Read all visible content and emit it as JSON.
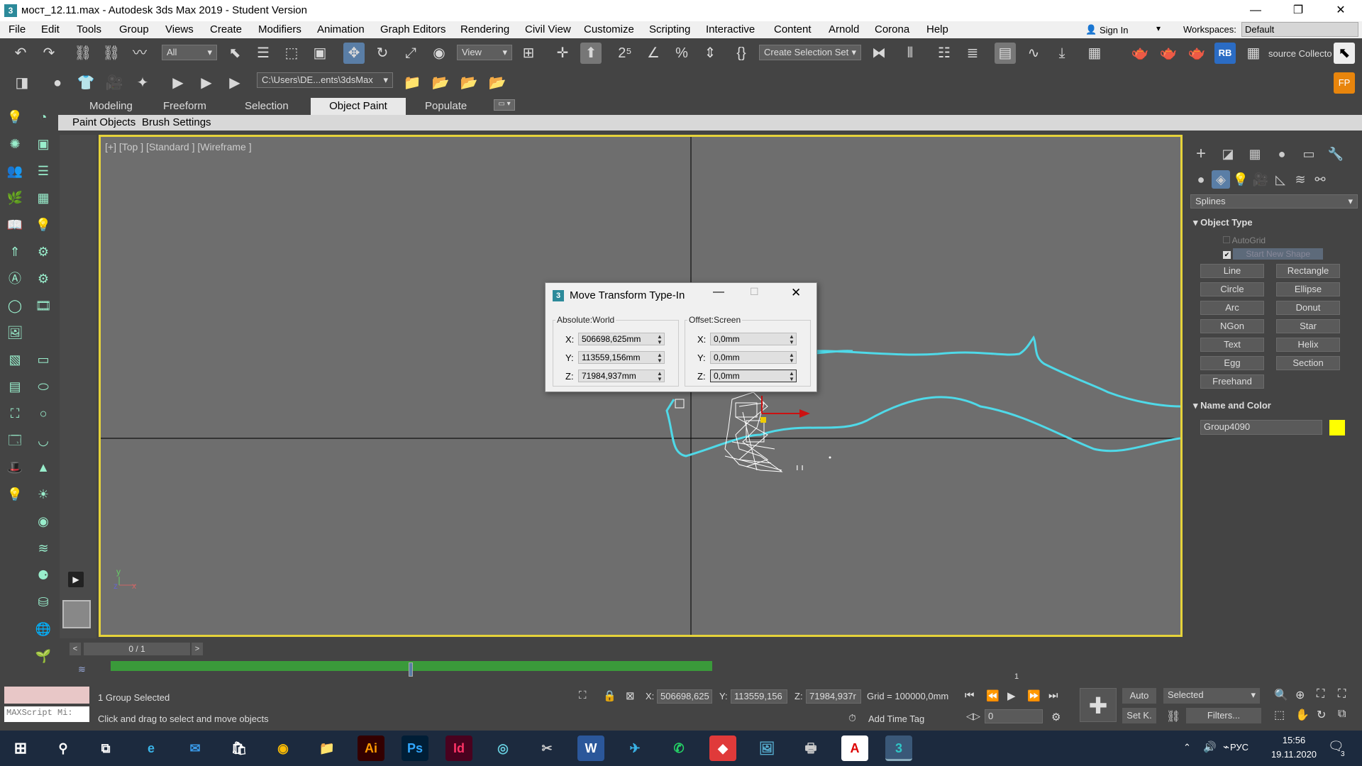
{
  "window": {
    "title": "мост_12.11.max - Autodesk 3ds Max 2019 - Student Version",
    "app_icon": "3",
    "controls": [
      "—",
      "❐",
      "✕"
    ]
  },
  "menu": {
    "items": [
      "File",
      "Edit",
      "Tools",
      "Group",
      "Views",
      "Create",
      "Modifiers",
      "Animation",
      "Graph Editors",
      "Rendering",
      "Civil View",
      "Customize",
      "Scripting",
      "Interactive",
      "Content",
      "Arnold",
      "Corona",
      "Help"
    ],
    "sign_in": "Sign In",
    "workspaces_label": "Workspaces:",
    "workspace_value": "Default"
  },
  "toolbar": {
    "filter_value": "All",
    "ref_coord_value": "View",
    "selection_set_value": "Create Selection Set",
    "project_path": "C:\\Users\\DE...ents\\3dsMax",
    "resource_collector": "source Collecto",
    "rb_label": "RB"
  },
  "ribbon": {
    "tabs": [
      "Modeling",
      "Freeform",
      "Selection",
      "Object Paint",
      "Populate"
    ],
    "active_tab": "Object Paint",
    "sub_items": [
      "Paint Objects",
      "Brush Settings"
    ]
  },
  "viewport": {
    "label": "[+] [Top ] [Standard ] [Wireframe ]",
    "axis_y": "y",
    "axis_z": "z",
    "axis_x": "x",
    "accent_border": "#e6d33a",
    "spline_color": "#4fd9e8"
  },
  "dialog": {
    "title": "Move Transform Type-In",
    "absolute_title": "Absolute:World",
    "offset_title": "Offset:Screen",
    "absolute": {
      "x": "506698,625mm",
      "y": "113559,156mm",
      "z": "71984,937mm"
    },
    "offset": {
      "x": "0,0mm",
      "y": "0,0mm",
      "z": "0,0mm"
    },
    "labels": {
      "x": "X:",
      "y": "Y:",
      "z": "Z:"
    },
    "min_label": "—",
    "max_label": "☐",
    "close_label": "✕"
  },
  "command_panel": {
    "category_value": "Splines",
    "rollout_object_type": "Object Type",
    "autogrid_label": "AutoGrid",
    "start_new_shape_label": "Start New Shape",
    "buttons": [
      "Line",
      "Rectangle",
      "Circle",
      "Ellipse",
      "Arc",
      "Donut",
      "NGon",
      "Star",
      "Text",
      "Helix",
      "Egg",
      "Section",
      "Freehand"
    ],
    "rollout_name_color": "Name and Color",
    "object_name": "Group4090",
    "object_color": "#ffff00"
  },
  "timeline": {
    "frame_counter": "0 / 1",
    "end_tick": "1"
  },
  "status": {
    "maxscript_placeholder": "MAXScript Mi:",
    "selection_status": "1 Group Selected",
    "prompt": "Click and drag to select and move objects",
    "x_label": "X:",
    "x_value": "506698,625",
    "y_label": "Y:",
    "y_value": "113559,156",
    "z_label": "Z:",
    "z_value": "71984,937r",
    "grid": "Grid = 100000,0mm",
    "add_time_tag": "Add Time Tag",
    "auto_key": "Auto",
    "set_key": "Set K.",
    "selected_value": "Selected",
    "filters": "Filters...",
    "frame_value": "0"
  },
  "taskbar": {
    "lang": "РУС",
    "time": "15:56",
    "date": "19.11.2020",
    "notifications": "3"
  }
}
